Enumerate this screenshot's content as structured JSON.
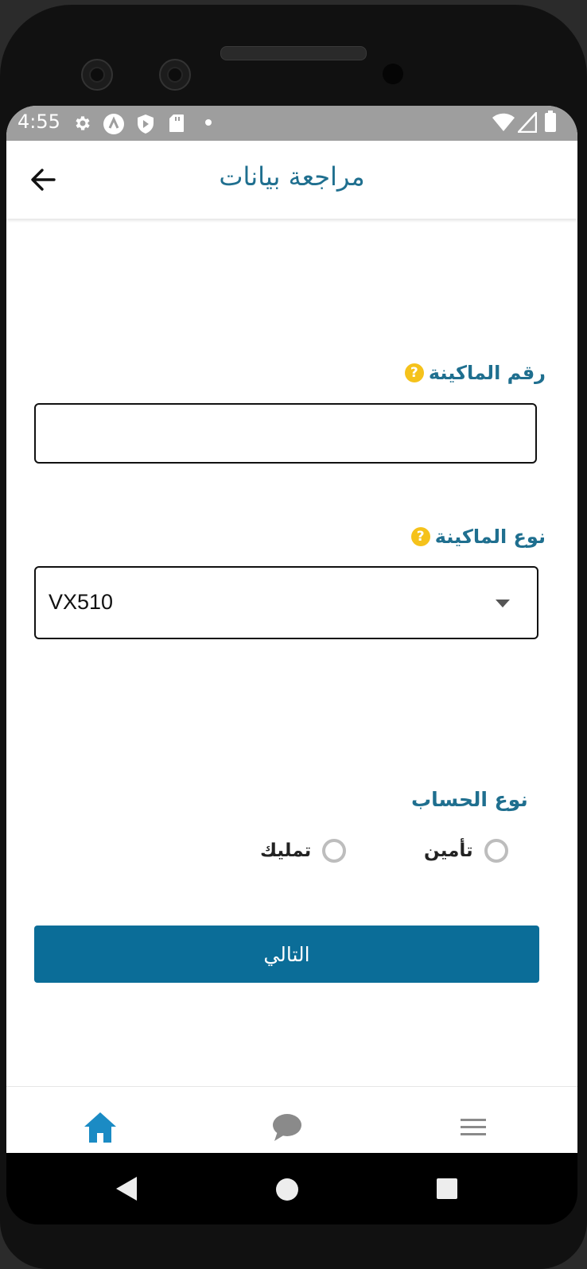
{
  "status_bar": {
    "time": "4:55",
    "left_icons": [
      "gear-icon",
      "a-icon",
      "shield-play-icon",
      "sd-card-icon",
      "dot-icon"
    ],
    "right_icons": [
      "wifi-icon",
      "signal-icon",
      "battery-icon"
    ]
  },
  "app_bar": {
    "title": "مراجعة بيانات",
    "back_icon": "arrow-left-icon"
  },
  "form": {
    "machine_number": {
      "label": "رقم الماكينة",
      "help_glyph": "?",
      "value": ""
    },
    "machine_type": {
      "label": "نوع الماكينة",
      "help_glyph": "?",
      "selected": "VX510"
    },
    "account_type": {
      "label": "نوع الحساب",
      "options": [
        "تأمين",
        "تمليك"
      ]
    },
    "next_label": "التالي"
  },
  "bottom_nav": {
    "items": [
      "home-icon",
      "chat-icon",
      "menu-icon"
    ],
    "active": "home-icon"
  },
  "colors": {
    "primary": "#0b6d98",
    "title_text": "#1f6f8f",
    "help_badge": "#f5c21b",
    "status_bar": "#9e9e9e"
  }
}
